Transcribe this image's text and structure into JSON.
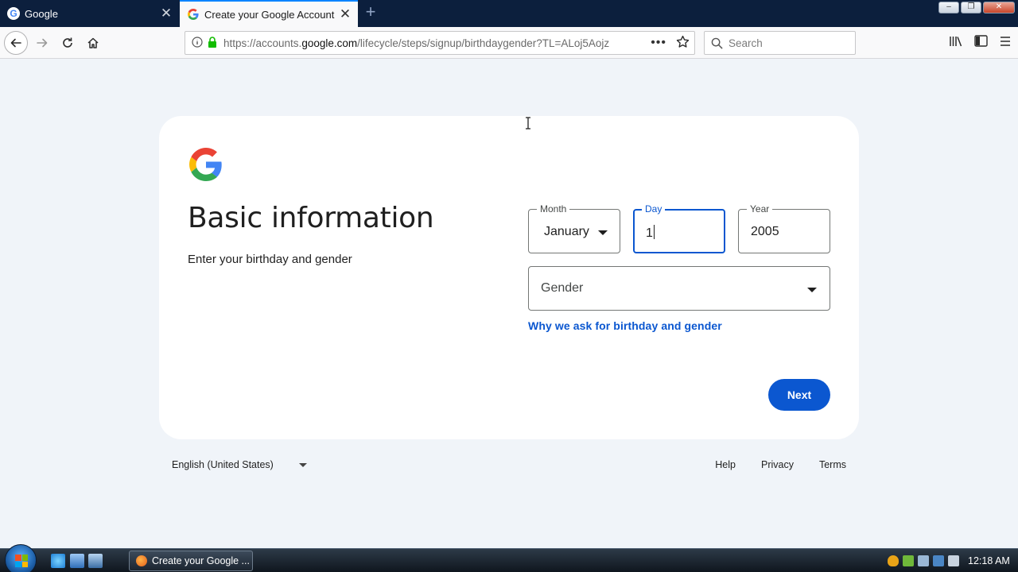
{
  "browser": {
    "tabs": [
      {
        "title": "Google",
        "active": false
      },
      {
        "title": "Create your Google Account",
        "active": true
      }
    ],
    "url_prefix": "https://accounts.",
    "url_domain": "google.com",
    "url_path": "/lifecycle/steps/signup/birthdaygender?TL=ALoj5Aojz",
    "search_placeholder": "Search"
  },
  "page": {
    "title": "Basic information",
    "subtitle": "Enter your birthday and gender",
    "month": {
      "label": "Month",
      "value": "January"
    },
    "day": {
      "label": "Day",
      "value": "1"
    },
    "year": {
      "label": "Year",
      "value": "2005"
    },
    "gender": {
      "placeholder": "Gender"
    },
    "why_link": "Why we ask for birthday and gender",
    "next_button": "Next"
  },
  "footer": {
    "language": "English (United States)",
    "links": [
      "Help",
      "Privacy",
      "Terms"
    ]
  },
  "taskbar": {
    "window_label": "Create your Google ...",
    "clock": "12:18 AM"
  },
  "colors": {
    "accent": "#0b57d0",
    "page_bg": "#f0f4f9",
    "tab_strip": "#0c1f3d"
  }
}
